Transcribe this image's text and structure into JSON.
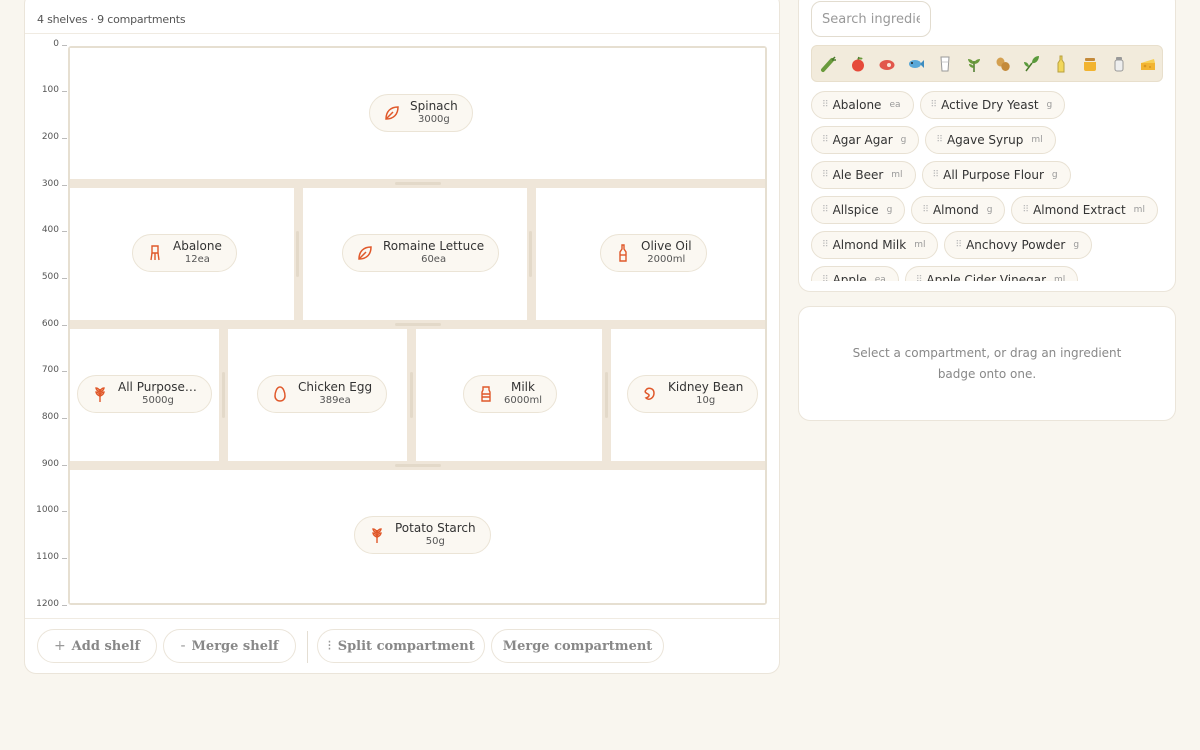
{
  "summary": "4 shelves · 9 compartments",
  "ruler": [
    "0",
    "100",
    "200",
    "300",
    "400",
    "500",
    "600",
    "700",
    "800",
    "900",
    "1000",
    "1100",
    "1200"
  ],
  "colors": {
    "accent": "#e0582a",
    "panel_border": "#ebe5da",
    "fridge": "#efe6d9"
  },
  "shelves": [
    {
      "compartments": [
        {
          "item": {
            "name": "Spinach",
            "qty": "3000g",
            "icon": "leaf-icon"
          }
        }
      ]
    },
    {
      "compartments": [
        {
          "item": {
            "name": "Abalone",
            "qty": "12ea",
            "icon": "squid-icon"
          }
        },
        {
          "item": {
            "name": "Romaine Lettuce",
            "qty": "60ea",
            "icon": "leaf-icon"
          }
        },
        {
          "item": {
            "name": "Olive Oil",
            "qty": "2000ml",
            "icon": "bottle-icon"
          }
        }
      ]
    },
    {
      "compartments": [
        {
          "item": {
            "name": "All Purpose ...",
            "qty": "5000g",
            "icon": "wheat-icon"
          }
        },
        {
          "item": {
            "name": "Chicken Egg",
            "qty": "389ea",
            "icon": "egg-icon"
          }
        },
        {
          "item": {
            "name": "Milk",
            "qty": "6000ml",
            "icon": "milk-carton-icon"
          }
        },
        {
          "item": {
            "name": "Kidney Bean",
            "qty": "10g",
            "icon": "bean-icon"
          }
        }
      ]
    },
    {
      "compartments": [
        {
          "item": {
            "name": "Potato Starch",
            "qty": "50g",
            "icon": "wheat-icon"
          }
        }
      ]
    }
  ],
  "toolbar": {
    "add_shelf": "Add shelf",
    "merge_shelf": "Merge shelf",
    "split_compartment": "Split compartment",
    "merge_compartment": "Merge compartment",
    "plus_symbol": "+",
    "minus_symbol": "-",
    "split_symbol": "⁝"
  },
  "search": {
    "placeholder": "Search ingredients"
  },
  "categories": [
    "vegetable-icon",
    "fruit-icon",
    "meat-icon",
    "fish-icon",
    "dairy-icon",
    "herb-icon",
    "nut-icon",
    "greens-icon",
    "oil-icon",
    "honey-icon",
    "seasoning-icon",
    "cheese-icon"
  ],
  "ingredients": [
    [
      {
        "name": "Abalone",
        "unit": "ea"
      },
      {
        "name": "Active Dry Yeast",
        "unit": "g"
      }
    ],
    [
      {
        "name": "Agar Agar",
        "unit": "g"
      },
      {
        "name": "Agave Syrup",
        "unit": "ml"
      }
    ],
    [
      {
        "name": "Ale Beer",
        "unit": "ml"
      },
      {
        "name": "All Purpose Flour",
        "unit": "g"
      }
    ],
    [
      {
        "name": "Allspice",
        "unit": "g"
      },
      {
        "name": "Almond",
        "unit": "g"
      },
      {
        "name": "Almond Extract",
        "unit": "ml"
      }
    ],
    [
      {
        "name": "Almond Milk",
        "unit": "ml"
      },
      {
        "name": "Anchovy Powder",
        "unit": "g"
      }
    ],
    [
      {
        "name": "Apple",
        "unit": "ea"
      },
      {
        "name": "Apple Cider Vinegar",
        "unit": "ml"
      }
    ]
  ],
  "hint": "Select a compartment, or drag an ingredient badge onto one."
}
